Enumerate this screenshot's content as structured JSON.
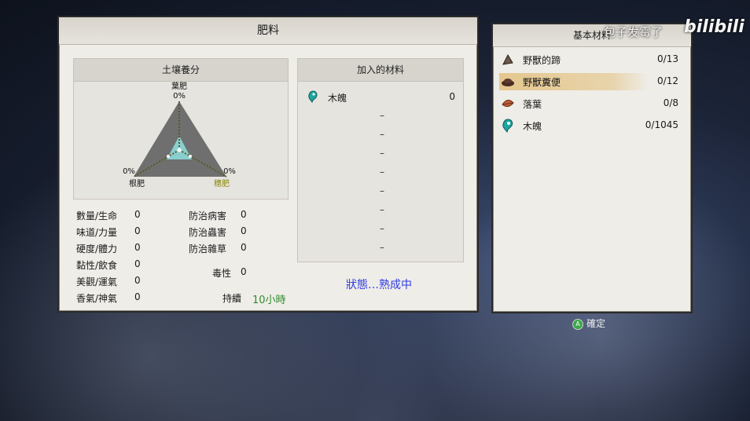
{
  "window_title": "肥料",
  "soil_panel": {
    "title": "土壤養分",
    "vertices": [
      {
        "name": "葉肥",
        "value": "0%"
      },
      {
        "name": "根肥",
        "value": "0%"
      },
      {
        "name": "穗肥",
        "value": "0%"
      }
    ]
  },
  "stats_left": [
    {
      "label": "數量/生命",
      "value": "0"
    },
    {
      "label": "味道/力量",
      "value": "0"
    },
    {
      "label": "硬度/體力",
      "value": "0"
    },
    {
      "label": "黏性/飲食",
      "value": "0"
    },
    {
      "label": "美觀/運氣",
      "value": "0"
    },
    {
      "label": "香氣/神氣",
      "value": "0"
    }
  ],
  "stats_right": [
    {
      "label": "防治病害",
      "value": "0"
    },
    {
      "label": "防治蟲害",
      "value": "0"
    },
    {
      "label": "防治雜草",
      "value": "0"
    },
    {
      "label": "毒性",
      "value": "0"
    }
  ],
  "duration": {
    "label": "持續",
    "value": "10小時"
  },
  "added_materials": {
    "title": "加入的材料",
    "first": {
      "name": "木魄",
      "count": "0"
    },
    "empty_slots": [
      "–",
      "–",
      "–",
      "–",
      "–",
      "–",
      "–",
      "–"
    ]
  },
  "status": "狀態…熟成中",
  "base_materials": {
    "title": "基本材料",
    "items": [
      {
        "name": "野獸的蹄",
        "count": "0/13",
        "icon": "hoof-icon"
      },
      {
        "name": "野獸糞便",
        "count": "0/12",
        "icon": "dung-icon",
        "selected": true
      },
      {
        "name": "落葉",
        "count": "0/8",
        "icon": "leaves-icon"
      },
      {
        "name": "木魄",
        "count": "0/1045",
        "icon": "spirit-icon"
      }
    ]
  },
  "confirm": {
    "button": "A",
    "label": "確定"
  },
  "watermark": {
    "text": "包子发霉了",
    "logo": "bilibili"
  },
  "colors": {
    "accent_blue": "#2f3be8",
    "duration_green": "#2e8a2e",
    "highlight": "#e2be78"
  }
}
